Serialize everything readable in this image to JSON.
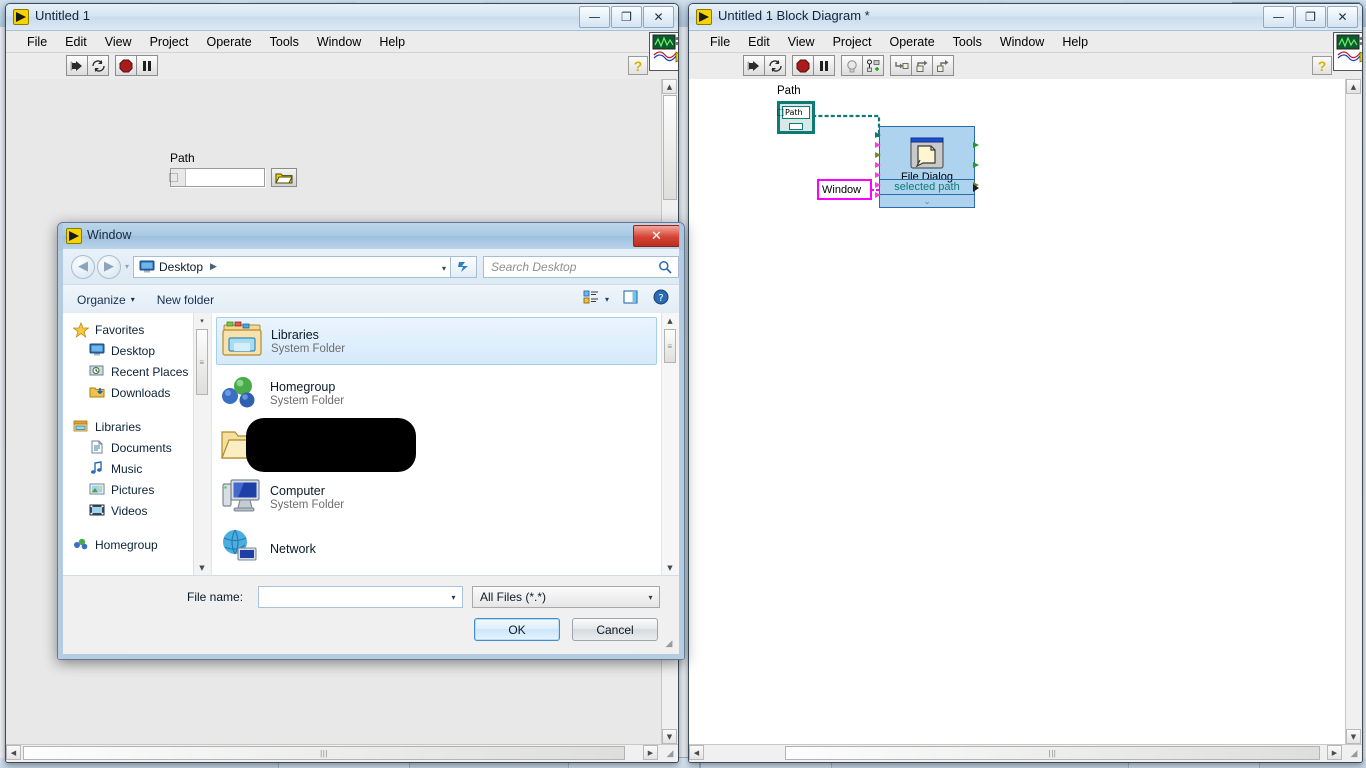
{
  "background": {
    "app": "web-browser",
    "tabs": [
      "",
      "",
      "",
      ""
    ],
    "window_buttons": [
      "minimize",
      "maximize",
      "close"
    ],
    "minimize_glyph": "—",
    "maximize_glyph": "❐",
    "close_glyph": "✕"
  },
  "front_panel_window": {
    "title": "Untitled 1",
    "icon": "labview-vi-icon",
    "window_buttons": {
      "minimize": "—",
      "maximize": "❐",
      "close": "✕"
    },
    "menus": [
      "File",
      "Edit",
      "View",
      "Project",
      "Operate",
      "Tools",
      "Window",
      "Help"
    ],
    "toolbar": [
      {
        "name": "run-button",
        "glyph": "run-arrow"
      },
      {
        "name": "run-continuously-button",
        "glyph": "run-continuous"
      },
      {
        "name": "abort-execution-button",
        "glyph": "abort-stop"
      },
      {
        "name": "pause-button",
        "glyph": "pause"
      }
    ],
    "help_button": "?",
    "vi_icon_badge": "1",
    "controls": {
      "path_label": "Path",
      "path_value": "",
      "path_browse_icon": "folder-browse-icon"
    },
    "scrollbars": {
      "h_thumb_grip": "|||",
      "left_arrow": "◀",
      "right_arrow": "▶",
      "up_arrow": "▲",
      "down_arrow": "▼"
    }
  },
  "block_diagram_window": {
    "title": "Untitled 1 Block Diagram *",
    "icon": "labview-vi-icon",
    "window_buttons": {
      "minimize": "—",
      "maximize": "❐",
      "close": "✕"
    },
    "menus": [
      "File",
      "Edit",
      "View",
      "Project",
      "Operate",
      "Tools",
      "Window",
      "Help"
    ],
    "toolbar": [
      {
        "name": "run-button",
        "glyph": "run-arrow"
      },
      {
        "name": "run-continuously-button",
        "glyph": "run-continuous"
      },
      {
        "name": "abort-execution-button",
        "glyph": "abort-stop"
      },
      {
        "name": "pause-button",
        "glyph": "pause"
      },
      {
        "name": "highlight-execution-button",
        "glyph": "lightbulb"
      },
      {
        "name": "retain-wire-values-button",
        "glyph": "probe-retain"
      },
      {
        "name": "step-into-button",
        "glyph": "step-into"
      },
      {
        "name": "step-over-button",
        "glyph": "step-over"
      },
      {
        "name": "step-out-button",
        "glyph": "step-out"
      }
    ],
    "help_button": "?",
    "vi_icon_badge": "1",
    "diagram": {
      "path_terminal": {
        "label": "Path",
        "inner_text": "Path"
      },
      "string_constant": {
        "text": "Window"
      },
      "subvi": {
        "name": "File Dialog",
        "output_row": "selected path",
        "grow_arrow": "⌄"
      }
    },
    "scrollbars": {
      "h_thumb_grip": "|||",
      "left_arrow": "◀",
      "right_arrow": "▶",
      "up_arrow": "▲",
      "down_arrow": "▼"
    }
  },
  "file_dialog": {
    "title": "Window",
    "close_glyph": "✕",
    "nav": {
      "back_glyph": "◀",
      "forward_glyph": "▶",
      "history_glyph": "▾",
      "address_icon": "desktop-icon",
      "address_text": "Desktop",
      "address_separator": "▶",
      "address_dropdown": "▾",
      "refresh_glyph": "↯",
      "search_placeholder": "Search Desktop",
      "search_icon": "magnifier-icon"
    },
    "toolbar": {
      "organize": "Organize",
      "organize_caret": "▾",
      "new_folder": "New folder",
      "view_icon": "change-view-icon",
      "view_caret": "▾",
      "preview_icon": "preview-pane-icon",
      "help_icon": "help-icon"
    },
    "sidebar": [
      {
        "label": "Favorites",
        "icon": "star-icon",
        "level": "head"
      },
      {
        "label": "Desktop",
        "icon": "desktop-icon",
        "level": "sub"
      },
      {
        "label": "Recent Places",
        "icon": "recent-places-icon",
        "level": "sub"
      },
      {
        "label": "Downloads",
        "icon": "downloads-icon",
        "level": "sub"
      },
      {
        "label": "Libraries",
        "icon": "libraries-icon",
        "level": "head"
      },
      {
        "label": "Documents",
        "icon": "documents-icon",
        "level": "sub"
      },
      {
        "label": "Music",
        "icon": "music-icon",
        "level": "sub"
      },
      {
        "label": "Pictures",
        "icon": "pictures-icon",
        "level": "sub"
      },
      {
        "label": "Videos",
        "icon": "videos-icon",
        "level": "sub"
      },
      {
        "label": "Homegroup",
        "icon": "homegroup-icon",
        "level": "head"
      }
    ],
    "files": [
      {
        "name": "Libraries",
        "sub": "System Folder",
        "icon": "libraries-folder-icon",
        "selected": true,
        "redacted": false
      },
      {
        "name": "Homegroup",
        "sub": "System Folder",
        "icon": "homegroup-icon",
        "selected": false,
        "redacted": false
      },
      {
        "name": "",
        "sub": "",
        "icon": "open-folder-icon",
        "selected": false,
        "redacted": true
      },
      {
        "name": "Computer",
        "sub": "System Folder",
        "icon": "computer-icon",
        "selected": false,
        "redacted": false
      },
      {
        "name": "Network",
        "sub": "",
        "icon": "network-icon",
        "selected": false,
        "redacted": false
      }
    ],
    "footer": {
      "file_name_label": "File name:",
      "file_name_value": "",
      "file_name_dropdown": "▾",
      "file_type_value": "All Files (*.*)",
      "file_type_dropdown": "▾",
      "ok_label": "OK",
      "cancel_label": "Cancel"
    }
  },
  "colors": {
    "labview_chrome": "#ececec",
    "diagram_bg": "#ffffff",
    "panel_bg": "#e8e8e8",
    "subvi_fill": "#aed3ef",
    "subvi_border": "#2b6ca8",
    "path_terminal_border": "#0c7b76",
    "string_constant_border": "#ff00ff",
    "wire_path": "#0c7b76",
    "wire_string": "#ff00ff",
    "selection_blue": "#d6eafb",
    "dialog_title": "#a9c8e2"
  }
}
